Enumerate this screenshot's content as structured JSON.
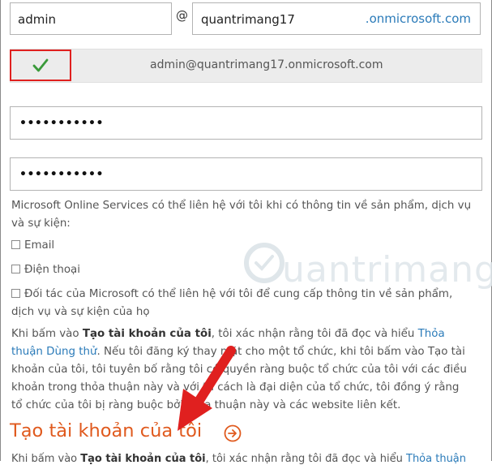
{
  "form": {
    "username_value": "admin",
    "at_symbol": "@",
    "domain_value": "quantrimang17",
    "domain_suffix": ".onmicrosoft.com",
    "verified_email": "admin@quantrimang17.onmicrosoft.com",
    "password_masked": "•••••••••••",
    "confirm_password_masked": "•••••••••••"
  },
  "consent": {
    "text": "Microsoft Online Services có thể liên hệ với tôi khi có thông tin về sản phẩm, dịch vụ và sự kiện:",
    "options": [
      {
        "label": "Email",
        "checked": false
      },
      {
        "label": "Điện thoại",
        "checked": false
      },
      {
        "label": "Đối tác của Microsoft có thể liên hệ với tôi để cung cấp thông tin về sản phẩm, dịch vụ và sự kiện của họ",
        "checked": false
      }
    ]
  },
  "legal": {
    "prefix": "Khi bấm vào ",
    "bold": "Tạo tài khoản của tôi",
    "middle": ", tôi xác nhận rằng tôi đã đọc và hiểu ",
    "link": "Thỏa thuận Dùng thử",
    "suffix": ". Nếu tôi đăng ký thay mặt cho một tổ chức, khi tôi bấm vào Tạo tài khoản của tôi, tôi tuyên bố rằng tôi có quyền ràng buộc tổ chức của tôi với các điều khoản trong thỏa thuận này và với tư cách là đại diện của tổ chức, tôi đồng ý rằng tổ chức của tôi bị ràng buộc bởi thỏa thuận này và các website liên kết."
  },
  "action": {
    "create_label": "Tạo tài khoản của tôi"
  },
  "bottom_cut": {
    "prefix": "Khi bấm vào ",
    "bold": "Tạo tài khoản của tôi",
    "middle": ", tôi xác nhận rằng tôi đã đọc và hiểu ",
    "link": "Thỏa thuận"
  },
  "watermark": {
    "text": "uantrimang"
  },
  "colors": {
    "accent_orange": "#e05a1e",
    "link_blue": "#2b7bb9",
    "highlight_red": "#e0201f",
    "check_green": "#3a9a3a"
  }
}
